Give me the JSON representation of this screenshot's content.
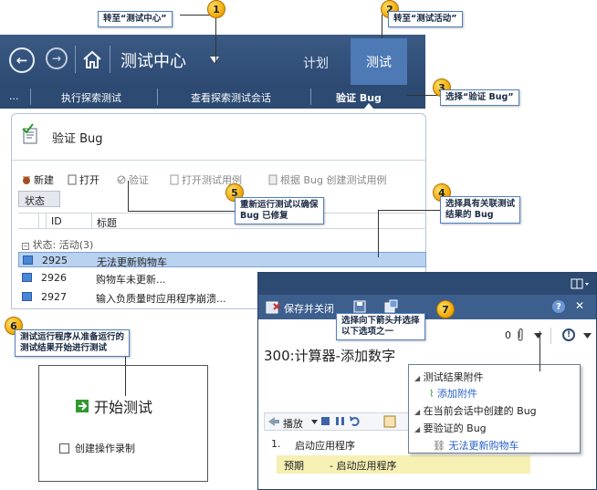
{
  "callouts": {
    "c1": {
      "num": "1",
      "text": "转至“测试中心”"
    },
    "c2": {
      "num": "2",
      "text": "转至“测试活动”"
    },
    "c3": {
      "num": "3",
      "text": "选择“验证 Bug”"
    },
    "c4": {
      "num": "4",
      "line1": "选择具有关联测试",
      "line2": "结果的 Bug"
    },
    "c5": {
      "num": "5",
      "line1": "重新运行测试以确保",
      "line2": "Bug 已修复"
    },
    "c6": {
      "num": "6",
      "line1": "测试运行程序从准备运行的",
      "line2": "测试结果开始进行测试"
    },
    "c7": {
      "num": "7",
      "line1": "选择向下箭头并选择",
      "line2": "以下选项之一"
    }
  },
  "hub": {
    "title": "测试中心",
    "tab_plan": "计划",
    "tab_test": "测试"
  },
  "subnav": {
    "ellipsis": "...",
    "explore": "执行探索测试",
    "view_sessions": "查看探索测试会话",
    "verify": "验证 Bug"
  },
  "panel": {
    "title": "验证 Bug",
    "toolbar": {
      "new": "新建",
      "open": "打开",
      "verify": "验证",
      "open_test_case": "打开测试用例",
      "create_test_case": "根据 Bug 创建测试用例"
    },
    "state_header": "状态",
    "columns": {
      "id": "ID",
      "title": "标题"
    },
    "group": "状态: 活动(3)",
    "rows": [
      {
        "id": "2925",
        "title": "无法更新购物车"
      },
      {
        "id": "2926",
        "title": "购物车未更新..."
      },
      {
        "id": "2927",
        "title": "输入负质量时应用程序崩溃..."
      }
    ]
  },
  "runner": {
    "save_close": "保存并关闭",
    "help": "?",
    "close": "✕",
    "attach_count": "0",
    "case_title": "300:计算器-添加数字",
    "play": "播放",
    "step1_num": "1.",
    "step1_text": "启动应用程序",
    "expected_label": "预期",
    "expected_text": "- 启动应用程序"
  },
  "dropdown": {
    "section1": "测试结果附件",
    "add_attachment": "添加附件",
    "section2": "在当前会话中创建的 Bug",
    "section3": "要验证的 Bug",
    "bug_link": "无法更新购物车"
  },
  "start": {
    "start_test": "开始测试",
    "record": "创建操作录制"
  },
  "colors": {
    "hub_bg": "#2c4a72",
    "active_tab": "#4d79b5",
    "selected_row": "#b8d2f0",
    "callout_border": "#4f7fc0"
  }
}
